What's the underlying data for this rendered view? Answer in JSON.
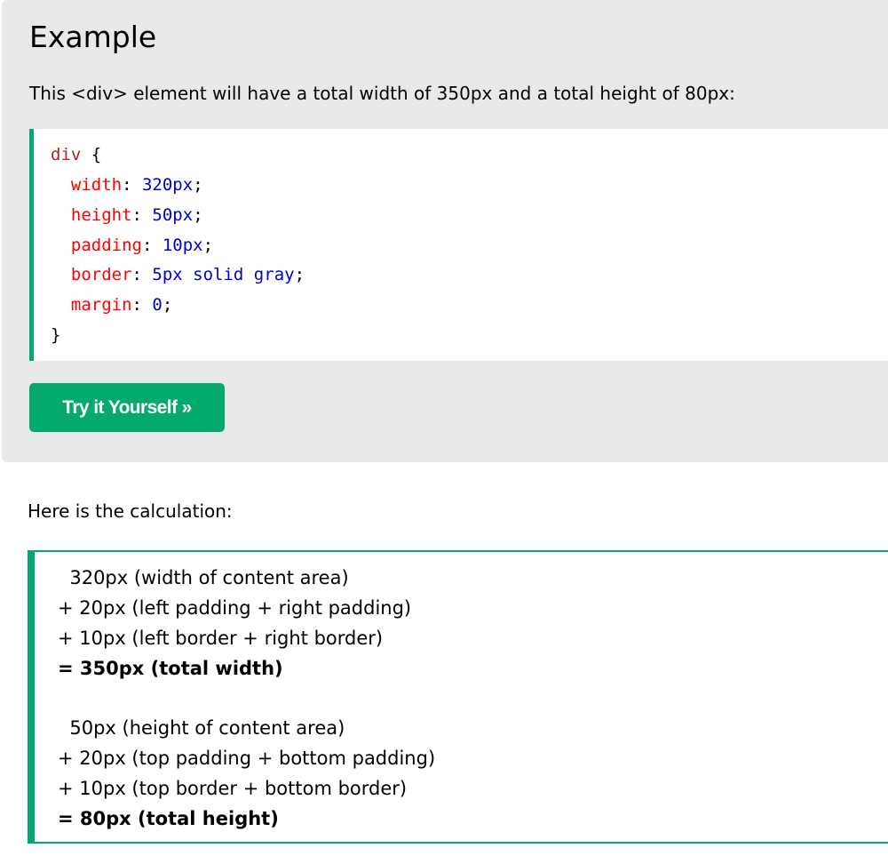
{
  "example": {
    "heading": "Example",
    "description": "This <div> element will have a total width of 350px and a total height of 80px:",
    "code": {
      "selector": "div",
      "open_brace": " {",
      "declarations": [
        {
          "property": "width",
          "value": "320px"
        },
        {
          "property": "height",
          "value": "50px"
        },
        {
          "property": "padding",
          "value": "10px"
        },
        {
          "property": "border",
          "value": "5px solid gray"
        },
        {
          "property": "margin",
          "value": "0"
        }
      ],
      "close_brace": "}"
    },
    "try_button_label": "Try it Yourself »"
  },
  "calculation": {
    "intro": "Here is the calculation:",
    "width_lines": [
      "  320px (width of content area)",
      "+ 20px (left padding + right padding)",
      "+ 10px (left border + right border)",
      "= 350px (total width)"
    ],
    "height_lines": [
      "  50px (height of content area)",
      "+ 20px (top padding + bottom padding)",
      "+ 10px (top border + bottom border)",
      "= 80px (total height)"
    ]
  },
  "colors": {
    "accent": "#04aa6d",
    "panel_background": "#e7e9eb",
    "selector": "#a52a2a",
    "property": "#ff0000",
    "value": "#0000cd"
  }
}
